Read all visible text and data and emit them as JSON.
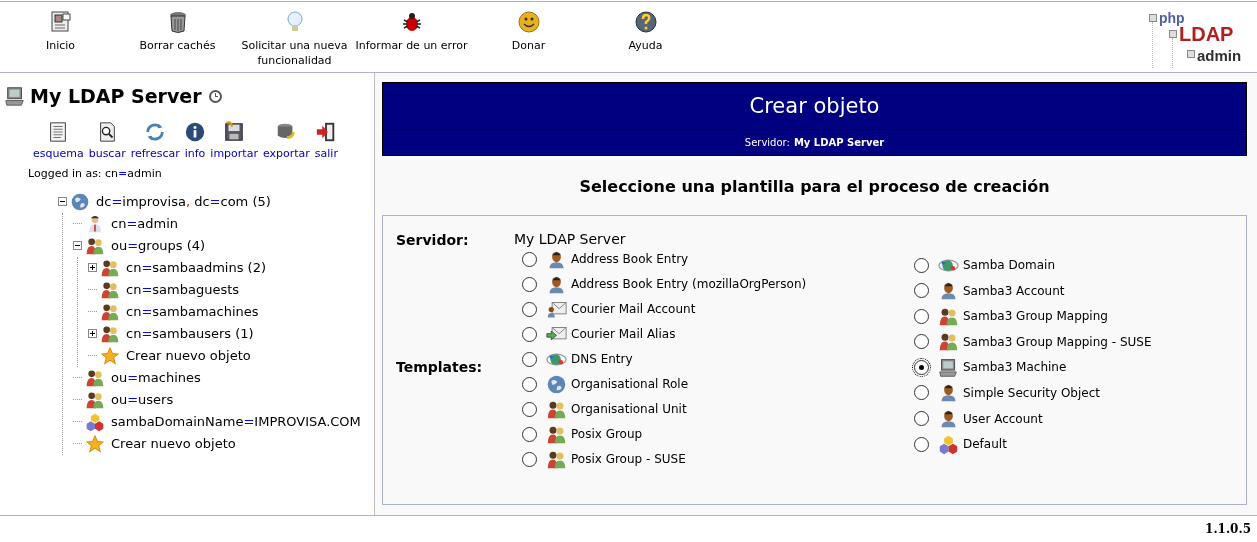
{
  "toolbar": [
    {
      "label": "Inicio",
      "kind": "card"
    },
    {
      "label": "Borrar cachés",
      "kind": "trash"
    },
    {
      "label": "Solicitar una nueva funcionalidad",
      "kind": "bulb"
    },
    {
      "label": "Informar de un error",
      "kind": "bug"
    },
    {
      "label": "Donar",
      "kind": "smiley"
    },
    {
      "label": "Ayuda",
      "kind": "help"
    }
  ],
  "logo": {
    "lines": [
      "php",
      "LDAP",
      "admin"
    ]
  },
  "sidebar": {
    "server_name": "My LDAP Server",
    "actions": [
      {
        "label": "esquema",
        "kind": "doc"
      },
      {
        "label": "buscar",
        "kind": "search"
      },
      {
        "label": "refrescar",
        "kind": "refresh"
      },
      {
        "label": "info",
        "kind": "info"
      },
      {
        "label": "importar",
        "kind": "disk"
      },
      {
        "label": "exportar",
        "kind": "db"
      },
      {
        "label": "salir",
        "kind": "exit"
      }
    ],
    "logged_in": "Logged in as: cn=admin",
    "tree": [
      {
        "label": "dc=improvisa, dc=com (5)",
        "kind": "globe",
        "expanded": true,
        "children": [
          {
            "label": "cn=admin",
            "kind": "admin"
          },
          {
            "label": "ou=groups (4)",
            "kind": "group",
            "expanded": true,
            "children": [
              {
                "label": "cn=sambaadmins (2)",
                "kind": "group",
                "expanded": false
              },
              {
                "label": "cn=sambaguests",
                "kind": "group"
              },
              {
                "label": "cn=sambamachines",
                "kind": "group"
              },
              {
                "label": "cn=sambausers (1)",
                "kind": "group",
                "expanded": false
              },
              {
                "label": "Crear nuevo objeto",
                "kind": "star"
              }
            ]
          },
          {
            "label": "ou=machines",
            "kind": "group"
          },
          {
            "label": "ou=users",
            "kind": "group"
          },
          {
            "label": "sambaDomainName=IMPROVISA.COM",
            "kind": "cubes"
          },
          {
            "label": "Crear nuevo objeto",
            "kind": "star"
          }
        ]
      }
    ]
  },
  "main": {
    "title": "Crear objeto",
    "server_label": "Servidor:",
    "server_value": "My LDAP Server",
    "heading": "Seleccione una plantilla para el proceso de creación",
    "form": {
      "server_label": "Servidor:",
      "server_value": "My LDAP Server",
      "templates_label": "Templates:",
      "columns": [
        {
          "items": [
            {
              "label": "Address Book Entry",
              "kind": "person",
              "selected": false
            },
            {
              "label": "Address Book Entry (mozillaOrgPerson)",
              "kind": "person",
              "selected": false
            },
            {
              "label": "Courier Mail Account",
              "kind": "mail",
              "selected": false
            },
            {
              "label": "Courier Mail Alias",
              "kind": "mailarrow",
              "selected": false
            },
            {
              "label": "DNS Entry",
              "kind": "dns",
              "selected": false
            },
            {
              "label": "Organisational Role",
              "kind": "globe",
              "selected": false
            },
            {
              "label": "Organisational Unit",
              "kind": "group",
              "selected": false
            },
            {
              "label": "Posix Group",
              "kind": "group",
              "selected": false
            },
            {
              "label": "Posix Group - SUSE",
              "kind": "group",
              "selected": false
            }
          ]
        },
        {
          "items": [
            {
              "label": "Samba Domain",
              "kind": "dns",
              "selected": false
            },
            {
              "label": "Samba3 Account",
              "kind": "person",
              "selected": false
            },
            {
              "label": "Samba3 Group Mapping",
              "kind": "group",
              "selected": false
            },
            {
              "label": "Samba3 Group Mapping - SUSE",
              "kind": "group",
              "selected": false
            },
            {
              "label": "Samba3 Machine",
              "kind": "computer",
              "selected": true
            },
            {
              "label": "Simple Security Object",
              "kind": "person",
              "selected": false
            },
            {
              "label": "User Account",
              "kind": "person",
              "selected": false
            },
            {
              "label": "Default",
              "kind": "cubes",
              "selected": false
            }
          ]
        }
      ]
    }
  },
  "version": "1.1.0.5"
}
